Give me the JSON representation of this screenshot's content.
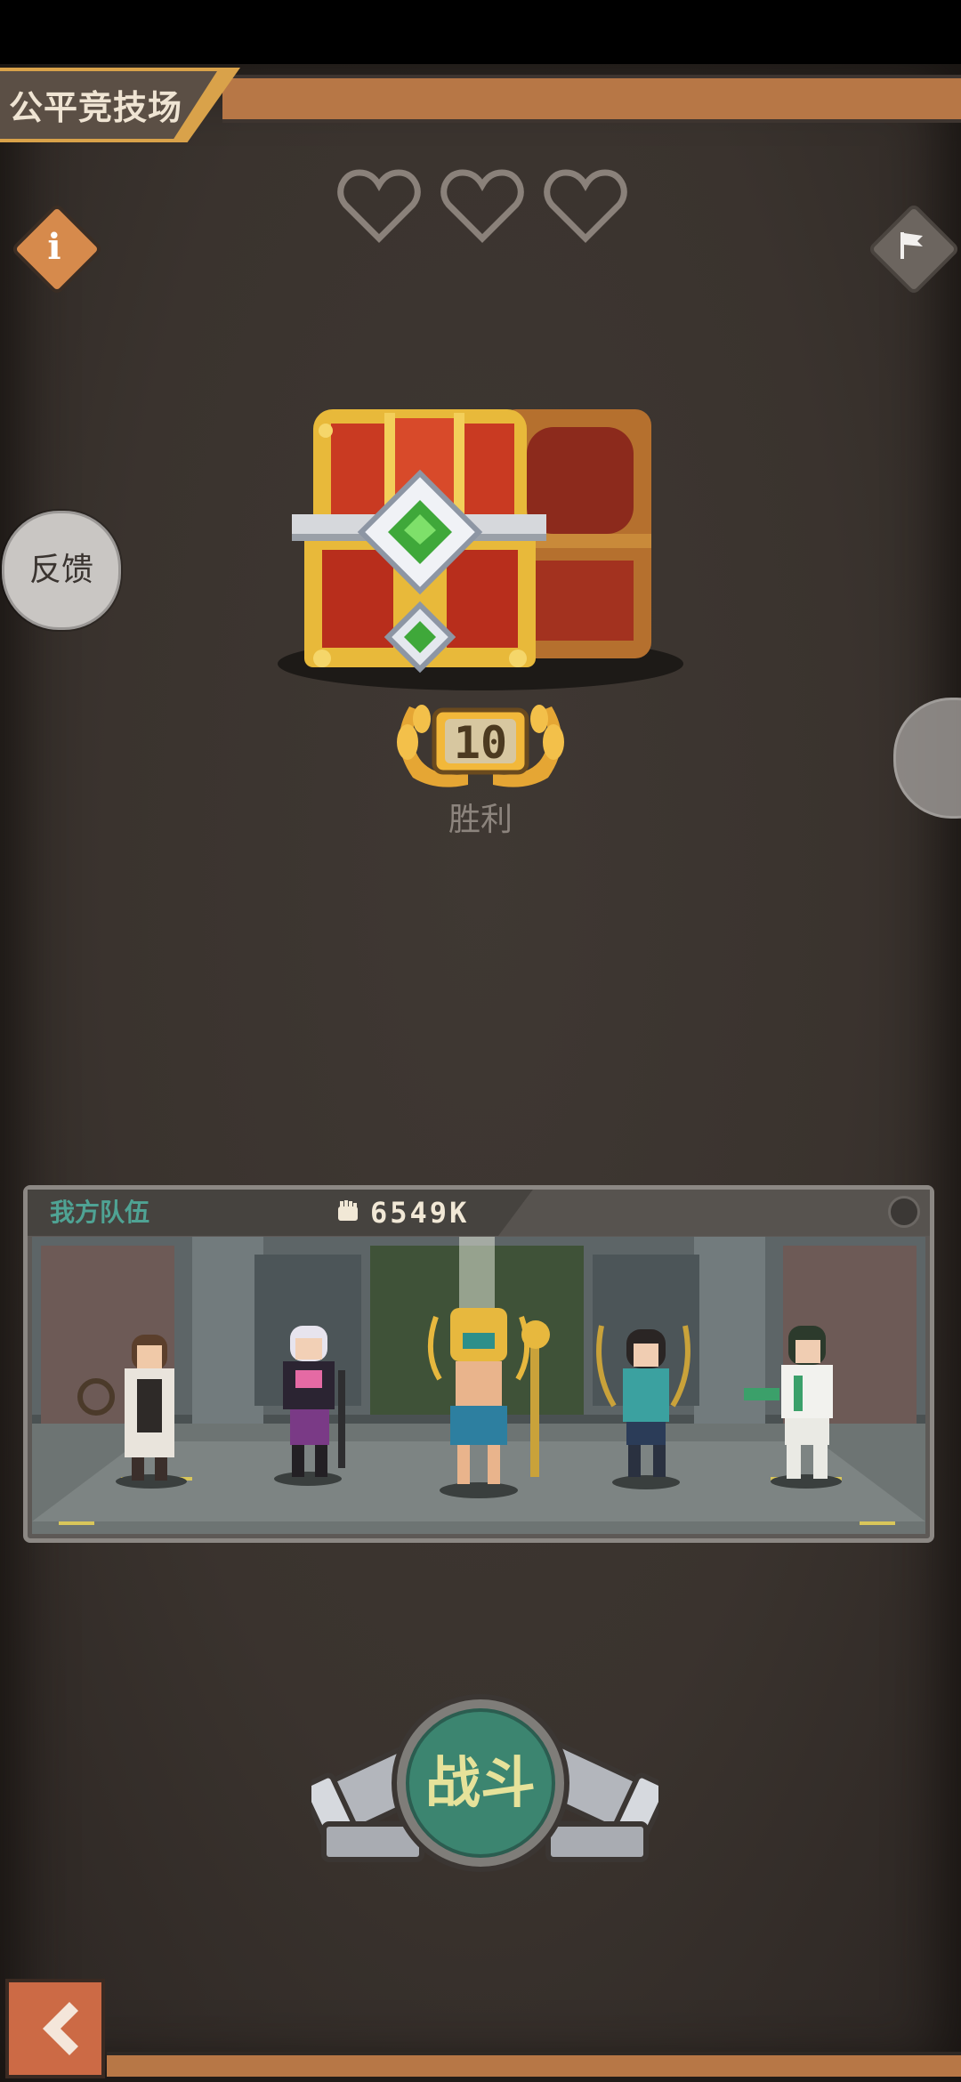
{
  "header": {
    "title": "公平竞技场"
  },
  "lives": {
    "total": 3,
    "filled": 0
  },
  "icons": {
    "info": "info-icon",
    "flag": "flag-icon",
    "heart": "heart-icon",
    "chest": "treasure-chest-icon",
    "laurel": "laurel-badge-icon",
    "power": "fist-icon",
    "settings": "gear-icon",
    "back": "back-arrow-icon"
  },
  "feedback": {
    "label": "反馈"
  },
  "reward": {
    "wins": "10",
    "wins_label": "胜利"
  },
  "team": {
    "label": "我方队伍",
    "power": "6549K"
  },
  "fight": {
    "label": "战斗"
  },
  "colors": {
    "background": "#3b342f",
    "accent_orange": "#d68a4c",
    "title_gold": "#d9a24a",
    "team_label": "#4fa394",
    "fight_button": "#3c8570"
  }
}
